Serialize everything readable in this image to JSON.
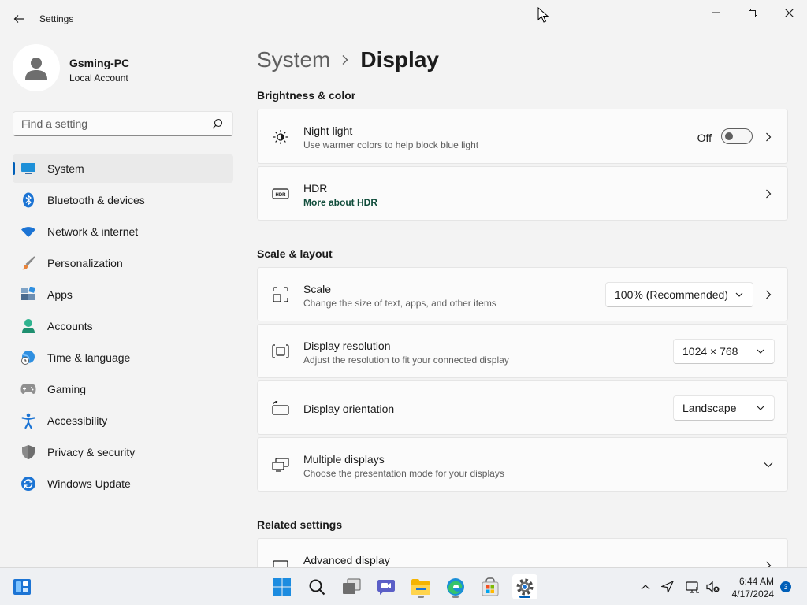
{
  "window": {
    "app_title": "Settings",
    "controls": [
      "minimize",
      "maximize",
      "close"
    ]
  },
  "profile": {
    "name": "Gsming-PC",
    "account_type": "Local Account"
  },
  "search": {
    "placeholder": "Find a setting"
  },
  "sidebar": {
    "items": [
      {
        "label": "System",
        "icon": "system-icon",
        "active": true
      },
      {
        "label": "Bluetooth & devices",
        "icon": "bluetooth-icon"
      },
      {
        "label": "Network & internet",
        "icon": "wifi-icon"
      },
      {
        "label": "Personalization",
        "icon": "paintbrush-icon"
      },
      {
        "label": "Apps",
        "icon": "apps-icon"
      },
      {
        "label": "Accounts",
        "icon": "accounts-icon"
      },
      {
        "label": "Time & language",
        "icon": "globe-clock-icon"
      },
      {
        "label": "Gaming",
        "icon": "gamepad-icon"
      },
      {
        "label": "Accessibility",
        "icon": "accessibility-icon"
      },
      {
        "label": "Privacy & security",
        "icon": "shield-icon"
      },
      {
        "label": "Windows Update",
        "icon": "update-icon"
      }
    ]
  },
  "breadcrumb": {
    "parent": "System",
    "current": "Display"
  },
  "sections": {
    "brightness": "Brightness & color",
    "scale": "Scale & layout",
    "related": "Related settings"
  },
  "night_light": {
    "title": "Night light",
    "subtitle": "Use warmer colors to help block blue light",
    "state": "Off"
  },
  "hdr": {
    "title": "HDR",
    "link": "More about HDR"
  },
  "scale": {
    "title": "Scale",
    "subtitle": "Change the size of text, apps, and other items",
    "value": "100% (Recommended)"
  },
  "resolution": {
    "title": "Display resolution",
    "subtitle": "Adjust the resolution to fit your connected display",
    "value": "1024 × 768"
  },
  "orientation": {
    "title": "Display orientation",
    "value": "Landscape"
  },
  "multiple_displays": {
    "title": "Multiple displays",
    "subtitle": "Choose the presentation mode for your displays"
  },
  "advanced_display": {
    "title": "Advanced display"
  },
  "taskbar": {
    "apps": [
      "widgets-icon",
      "start-icon",
      "search-icon",
      "task-view-icon",
      "teams-icon",
      "file-explorer-icon",
      "edge-icon",
      "store-icon",
      "settings-icon"
    ],
    "time": "6:44 AM",
    "date": "4/17/2024",
    "notification_count": "3"
  },
  "colors": {
    "accent": "#005fb8",
    "background": "#f3f3f3",
    "card": "#fbfbfb",
    "link_green": "#0f4c3a"
  }
}
